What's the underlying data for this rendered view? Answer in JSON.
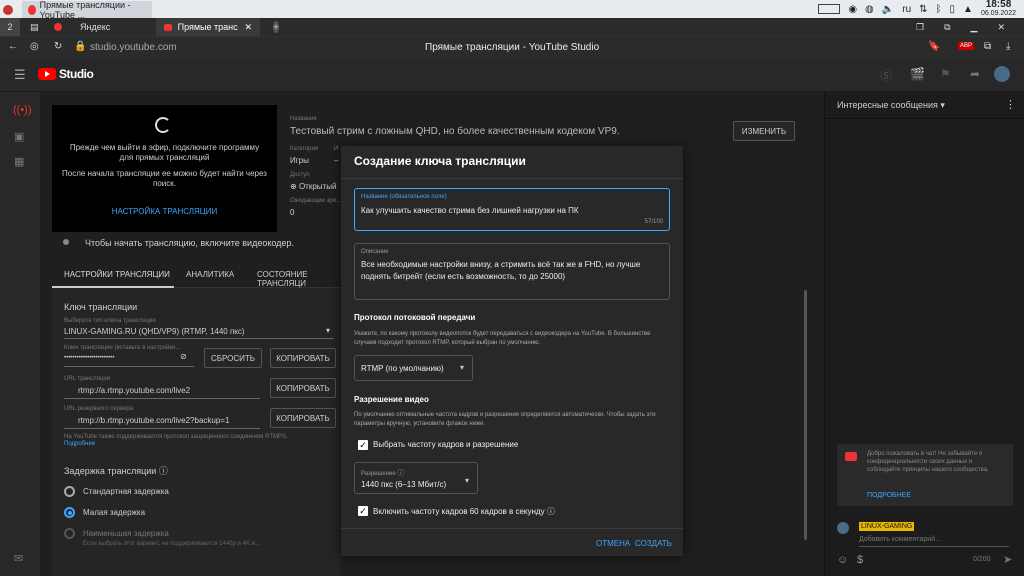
{
  "os": {
    "workspace": "2",
    "window_title": "Прямые трансляции - YouTube ...",
    "lang": "ru",
    "time": "18:58",
    "date": "06.09.2022"
  },
  "browser": {
    "tabs": [
      {
        "label": "Яндекс"
      },
      {
        "label": "Прямые трансляции - YouTube Studio"
      }
    ],
    "url": "studio.youtube.com",
    "page_title": "Прямые трансляции - YouTube Studio",
    "abp": "ABP"
  },
  "studio": {
    "logo": "Studio"
  },
  "preview": {
    "line1": "Прежде чем выйти в эфир, подключите программу для прямых трансляций",
    "line2": "После начала трансляции ее можно будет найти через поиск.",
    "settings_link": "НАСТРОЙКА ТРАНСЛЯЦИИ",
    "hint": "Чтобы начать трансляцию, включите видеокодер."
  },
  "info": {
    "name_label": "Название",
    "name_value": "Тестовый стрим с ложным QHD, но более качественным кодеком VP9.",
    "category_label": "Категория",
    "category_value": "Игры",
    "access_label": "Доступ",
    "access_value": "Открытый",
    "viewers_label": "Ожидающие зри...",
    "viewers_value": "0",
    "change_button": "ИЗМЕНИТЬ"
  },
  "tabs": [
    {
      "label": "НАСТРОЙКИ ТРАНСЛЯЦИИ"
    },
    {
      "label": "АНАЛИТИКА"
    },
    {
      "label": "СОСТОЯНИЕ ТРАНСЛЯЦИ"
    }
  ],
  "stream_key": {
    "heading": "Ключ трансляции",
    "select_label": "Выберите тип ключа трансляции",
    "select_value": "LINUX-GAMING.RU (QHD/VP9) (RTMP, 1440 пкс)",
    "key_label": "Ключ трансляции (вставьте в настройки...",
    "key_value": "••••••••••••••••••••••••",
    "reset": "СБРОСИТЬ",
    "copy": "КОПИРОВАТЬ",
    "url_label": "URL трансляции",
    "url_value": "rtmp://a.rtmp.youtube.com/live2",
    "backup_label": "URL резервного сервера",
    "backup_value": "rtmp://b.rtmp.youtube.com/live2?backup=1",
    "rtmps_note": "На YouTube также поддерживается протокол защищенного соединения RTMPS.",
    "more": "Подробнее"
  },
  "latency": {
    "heading": "Задержка трансляции",
    "opt1": "Стандартная задержка",
    "opt2": "Малая задержка",
    "opt3": "Наименьшая задержка",
    "note": "Если выбрать этот вариант, не поддерживаются 1440p и 4K и..."
  },
  "dialog": {
    "title": "Создание ключа трансляции",
    "name_label": "Название (обязательное поле)",
    "name_value": "Как улучшить качество стрима без лишней нагрузки на ПК",
    "name_counter": "57/100",
    "desc_label": "Описание",
    "desc_value": "Все необходимые настройки внизу, а стримить всё так же в FHD, но лучше поднять битрейт (если есть возможность, то до 25000)",
    "protocol_heading": "Протокол потоковой передачи",
    "protocol_text": "Укажите, по какому протоколу видеопоток будет передаваться с видеокодера на YouTube. В большинстве случаев подходит протокол RTMP, который выбран по умолчанию.",
    "protocol_value": "RTMP (по умолчанию)",
    "res_heading": "Разрешение видео",
    "res_text": "По умолчанию оптимальные частота кадров и разрешение определяются автоматически. Чтобы задать эти параметры вручную, установите флажок ниже.",
    "check1": "Выбрать частоту кадров и разрешение",
    "res_label": "Разрешение",
    "res_value": "1440 пкс (6–13 Мбит/с)",
    "check2": "Включить частоту кадров 60 кадров в секунду",
    "cancel": "ОТМЕНА",
    "create": "СОЗДАТЬ"
  },
  "chat": {
    "title": "Интересные сообщения",
    "welcome": "Добро пожаловать в чат! Не забывайте о конфиденциальности своих данных и соблюдайте принципы нашего сообщества.",
    "more": "ПОДРОБНЕЕ",
    "channel": "LINUX-GAMING",
    "placeholder": "Добавить комментарий...",
    "counter": "0/200"
  }
}
